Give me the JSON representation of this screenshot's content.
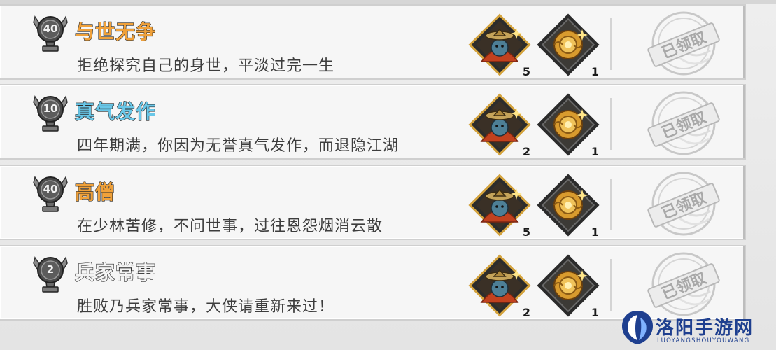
{
  "achievements": [
    {
      "level": "40",
      "title": "与世无争",
      "title_color": "#f0a13a",
      "desc": "拒绝探究自己的身世，平淡过完一生",
      "reward1_count": "5",
      "reward2_count": "1",
      "status": "已领取"
    },
    {
      "level": "10",
      "title": "真气发作",
      "title_color": "#69c7e8",
      "desc": "四年期满，你因为无誉真气发作，而退隐江湖",
      "reward1_count": "2",
      "reward2_count": "1",
      "status": "已领取"
    },
    {
      "level": "40",
      "title": "高僧",
      "title_color": "#f0a13a",
      "desc": "在少林苦修，不问世事，过往恩怨烟消云散",
      "reward1_count": "5",
      "reward2_count": "1",
      "status": "已领取"
    },
    {
      "level": "2",
      "title": "兵家常事",
      "title_color": "#f4f4f4",
      "desc": "胜败乃兵家常事，大侠请重新来过！",
      "reward1_count": "2",
      "reward2_count": "1",
      "status": "已领取"
    }
  ],
  "icons": {
    "badge": "trophy-badge-icon",
    "reward1": "robed-figure-reward-icon",
    "reward2": "golden-orb-reward-icon",
    "stamp": "claimed-stamp-icon"
  },
  "watermark": {
    "cn": "洛阳手游网",
    "en": "LUOYANGSHOUYOUWANG"
  }
}
